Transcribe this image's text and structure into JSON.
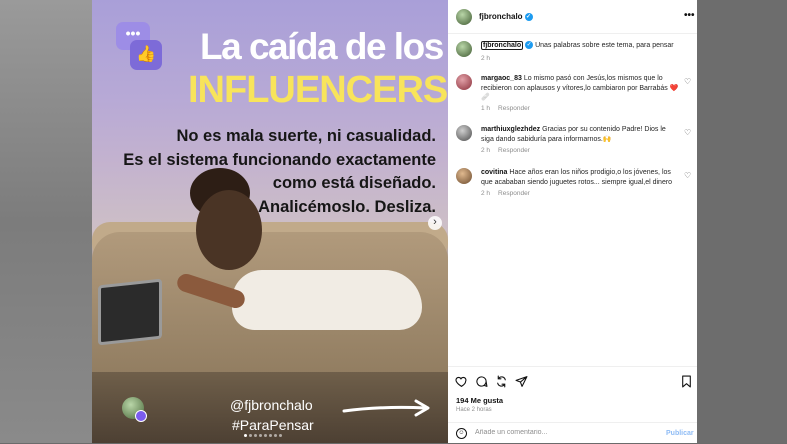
{
  "post": {
    "headline_line1": "La caída de los",
    "headline_line2": "INFLUENCERS",
    "body_lines": [
      "No es mala suerte, ni casualidad.",
      "Es el sistema funcionando exactamente",
      "como está diseñado.",
      "Analicémoslo. Desliza."
    ],
    "handle": "@fjbronchalo",
    "hashtag": "#ParaPensar",
    "carousel_dots": 8,
    "active_dot": 1
  },
  "header": {
    "username": "fjbronchalo",
    "more_icon": "more-horizontal-icon"
  },
  "caption": {
    "username": "fjbronchalo",
    "text": " Unas palabras sobre este tema, para pensar",
    "time": "2 h"
  },
  "comments": [
    {
      "username": "margaoc_83",
      "text": "Lo mismo pasó con Jesús,los mismos que lo recibieron con aplausos y vítores,lo cambiaron por Barrabás ❤️🩹",
      "time": "1 h",
      "reply": "Responder"
    },
    {
      "username": "marthiuxglezhdez",
      "text": "Gracias por su contenido Padre! Dios le siga dando sabiduría para informarnos.🙌",
      "time": "2 h",
      "reply": "Responder"
    },
    {
      "username": "covitina",
      "text": "Hace años eran los niños prodigio,o los jóvenes, los que acababan siendo juguetes rotos... siempre igual,el dinero",
      "time": "2 h",
      "reply": "Responder"
    }
  ],
  "actions": {
    "likes": "194 Me gusta",
    "time_ago": "Hace 2 horas"
  },
  "add_comment": {
    "placeholder": "Añade un comentario...",
    "publish": "Publicar"
  },
  "colors": {
    "verified": "#1d9bf0",
    "headline_yellow": "#f8e45b",
    "publish_disabled": "#8fbcf5"
  }
}
